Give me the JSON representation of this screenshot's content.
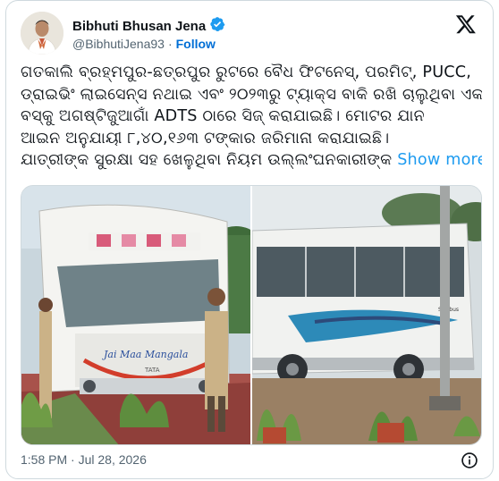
{
  "author": {
    "name": "Bibhuti Bhusan Jena",
    "handle": "@BibhutiJena93",
    "separator": "·",
    "follow_label": "Follow",
    "verified": true
  },
  "tweet": {
    "lines": [
      "ଗତକାଲି ବ୍ରହ୍ମପୁର-ଛତ୍ରପୁର ରୁଟରେ ବୈଧ ଫିଟନେସ୍, ପରମିଟ୍, PUCC,",
      "ଡ୍ରାଇଭିଂ ଲାଇସେନ୍ସ ନଥାଇ ଏବଂ ୨୦୨୩ରୁ ଟ୍ୟାକ୍ସ ବାକି ରଖି ଚାଲୁଥିବା ଏକ",
      "ବସ୍‌କୁ ଅଗଷ୍ଟିଜୁଆଗାଁ ADTS ଠାରେ ସିଜ୍ କରାଯାଇଛି। ମୋଟର ଯାନ",
      "ଆଇନ ଅନୁଯାୟୀ ୮,୪୦,୧୬୩ ଟଙ୍କାର ଜରିମାନା କରାଯାଇଛି।",
      "ଯାତ୍ରୀଙ୍କ ସୁରକ୍ଷା ସହ ଖେଳୁଥିବା ନିୟମ ଉଲ୍ଲଂଘନକାରୀଙ୍କ"
    ],
    "show_more_label": "Show more"
  },
  "media": {
    "photo1": {
      "bus_name": "Jai Maa Mangala",
      "brand": "TATA"
    },
    "photo2": {
      "brand": "Starbus"
    }
  },
  "meta": {
    "timestamp": "1:58 PM · Jul 28, 2026"
  },
  "icons": {
    "verified": "verified-badge-icon",
    "logo": "x-logo-icon",
    "info": "info-icon"
  },
  "colors": {
    "link": "#1d9bf0",
    "follow": "#006fd6",
    "verified": "#1d9bf0",
    "muted": "#536471"
  }
}
